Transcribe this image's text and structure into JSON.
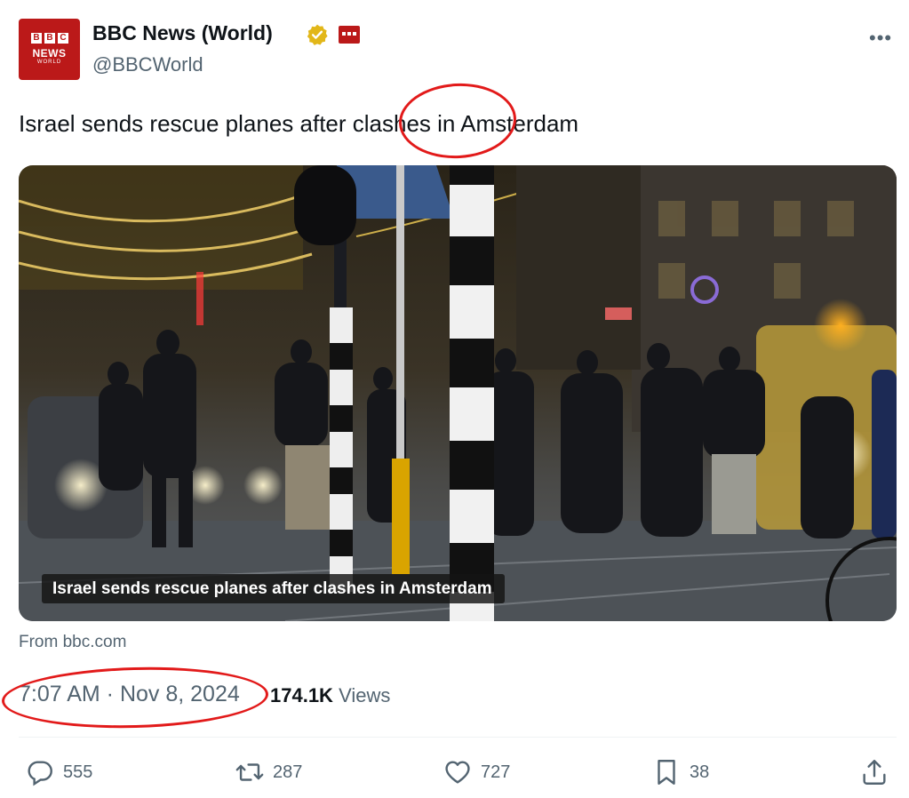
{
  "account": {
    "display_name": "BBC News (World)",
    "handle": "@BBCWorld",
    "avatar_letters": [
      "B",
      "B",
      "C"
    ],
    "avatar_news": "NEWS",
    "avatar_world": "WORLD",
    "verified_icon": "gold-checkmark-badge",
    "affiliate_icon": "bbc-affiliate-badge",
    "brand_color": "#bb1919",
    "more_label": "•••"
  },
  "tweet": {
    "text": "Israel sends rescue planes after clashes in Amsterdam",
    "media_caption": "Israel sends rescue planes after clashes in Amsterdam",
    "source": "From bbc.com",
    "timestamp": "7:07 AM · Nov 8, 2024",
    "views_count": "174.1K",
    "views_label": "Views"
  },
  "annotations": {
    "color": "#e21a1a",
    "circled": [
      "clashes",
      "7:07 AM · Nov 8, 2024"
    ]
  },
  "actions": [
    {
      "name": "reply",
      "icon": "speech-bubble-icon",
      "count": "555"
    },
    {
      "name": "repost",
      "icon": "repost-arrows-icon",
      "count": "287"
    },
    {
      "name": "like",
      "icon": "heart-icon",
      "count": "727"
    },
    {
      "name": "bookmark",
      "icon": "bookmark-icon",
      "count": "38"
    },
    {
      "name": "share",
      "icon": "share-upload-icon",
      "count": ""
    }
  ]
}
